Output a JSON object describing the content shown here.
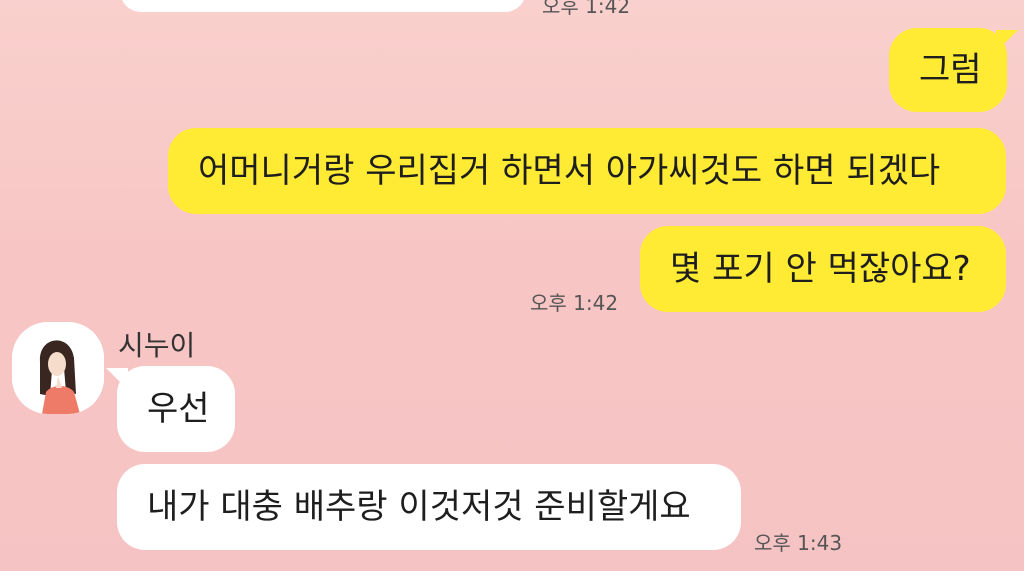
{
  "messages": {
    "top_time": "오후 1:42",
    "mine": [
      {
        "text": "그럼"
      },
      {
        "text": "어머니거랑 우리집거 하면서 아가씨것도 하면 되겠다"
      },
      {
        "text": "몇 포기 안 먹잖아요?"
      }
    ],
    "mine_time": "오후 1:42",
    "sender_name": "시누이",
    "theirs": [
      {
        "text": "우선"
      },
      {
        "text": "내가 대충 배추랑 이것저것 준비할게요"
      }
    ],
    "theirs_time": "오후 1:43"
  },
  "colors": {
    "my_bubble": "#ffeb33",
    "their_bubble": "#ffffff",
    "background": "#f7c6c4"
  },
  "icons": {
    "avatar": "profile-avatar-woman"
  }
}
